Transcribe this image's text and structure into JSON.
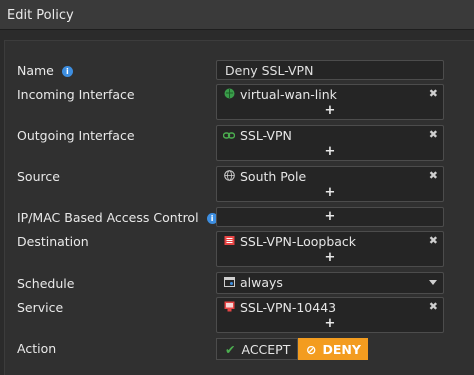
{
  "window": {
    "title": "Edit Policy"
  },
  "form": {
    "name": {
      "label": "Name",
      "value": "Deny SSL-VPN"
    },
    "incoming": {
      "label": "Incoming Interface",
      "entry": "virtual-wan-link",
      "icon": "wan-globe-icon"
    },
    "outgoing": {
      "label": "Outgoing Interface",
      "entry": "SSL-VPN",
      "icon": "link-icon"
    },
    "source": {
      "label": "Source",
      "entry": "South Pole",
      "icon": "globe-icon"
    },
    "ipmac": {
      "label": "IP/MAC Based Access Control"
    },
    "destination": {
      "label": "Destination",
      "entry": "SSL-VPN-Loopback",
      "icon": "address-icon"
    },
    "schedule": {
      "label": "Schedule",
      "value": "always",
      "icon": "calendar-icon"
    },
    "service": {
      "label": "Service",
      "entry": "SSL-VPN-10443",
      "icon": "service-icon"
    },
    "action": {
      "label": "Action",
      "accept": "ACCEPT",
      "deny": "DENY",
      "selected": "DENY"
    }
  },
  "symbols": {
    "add": "+",
    "remove": "✖",
    "check": "✔",
    "ban": "⊘",
    "info": "i"
  },
  "colors": {
    "accent_deny": "#f39c1f",
    "accept_check": "#4caf50",
    "info": "#3d8ee0"
  }
}
